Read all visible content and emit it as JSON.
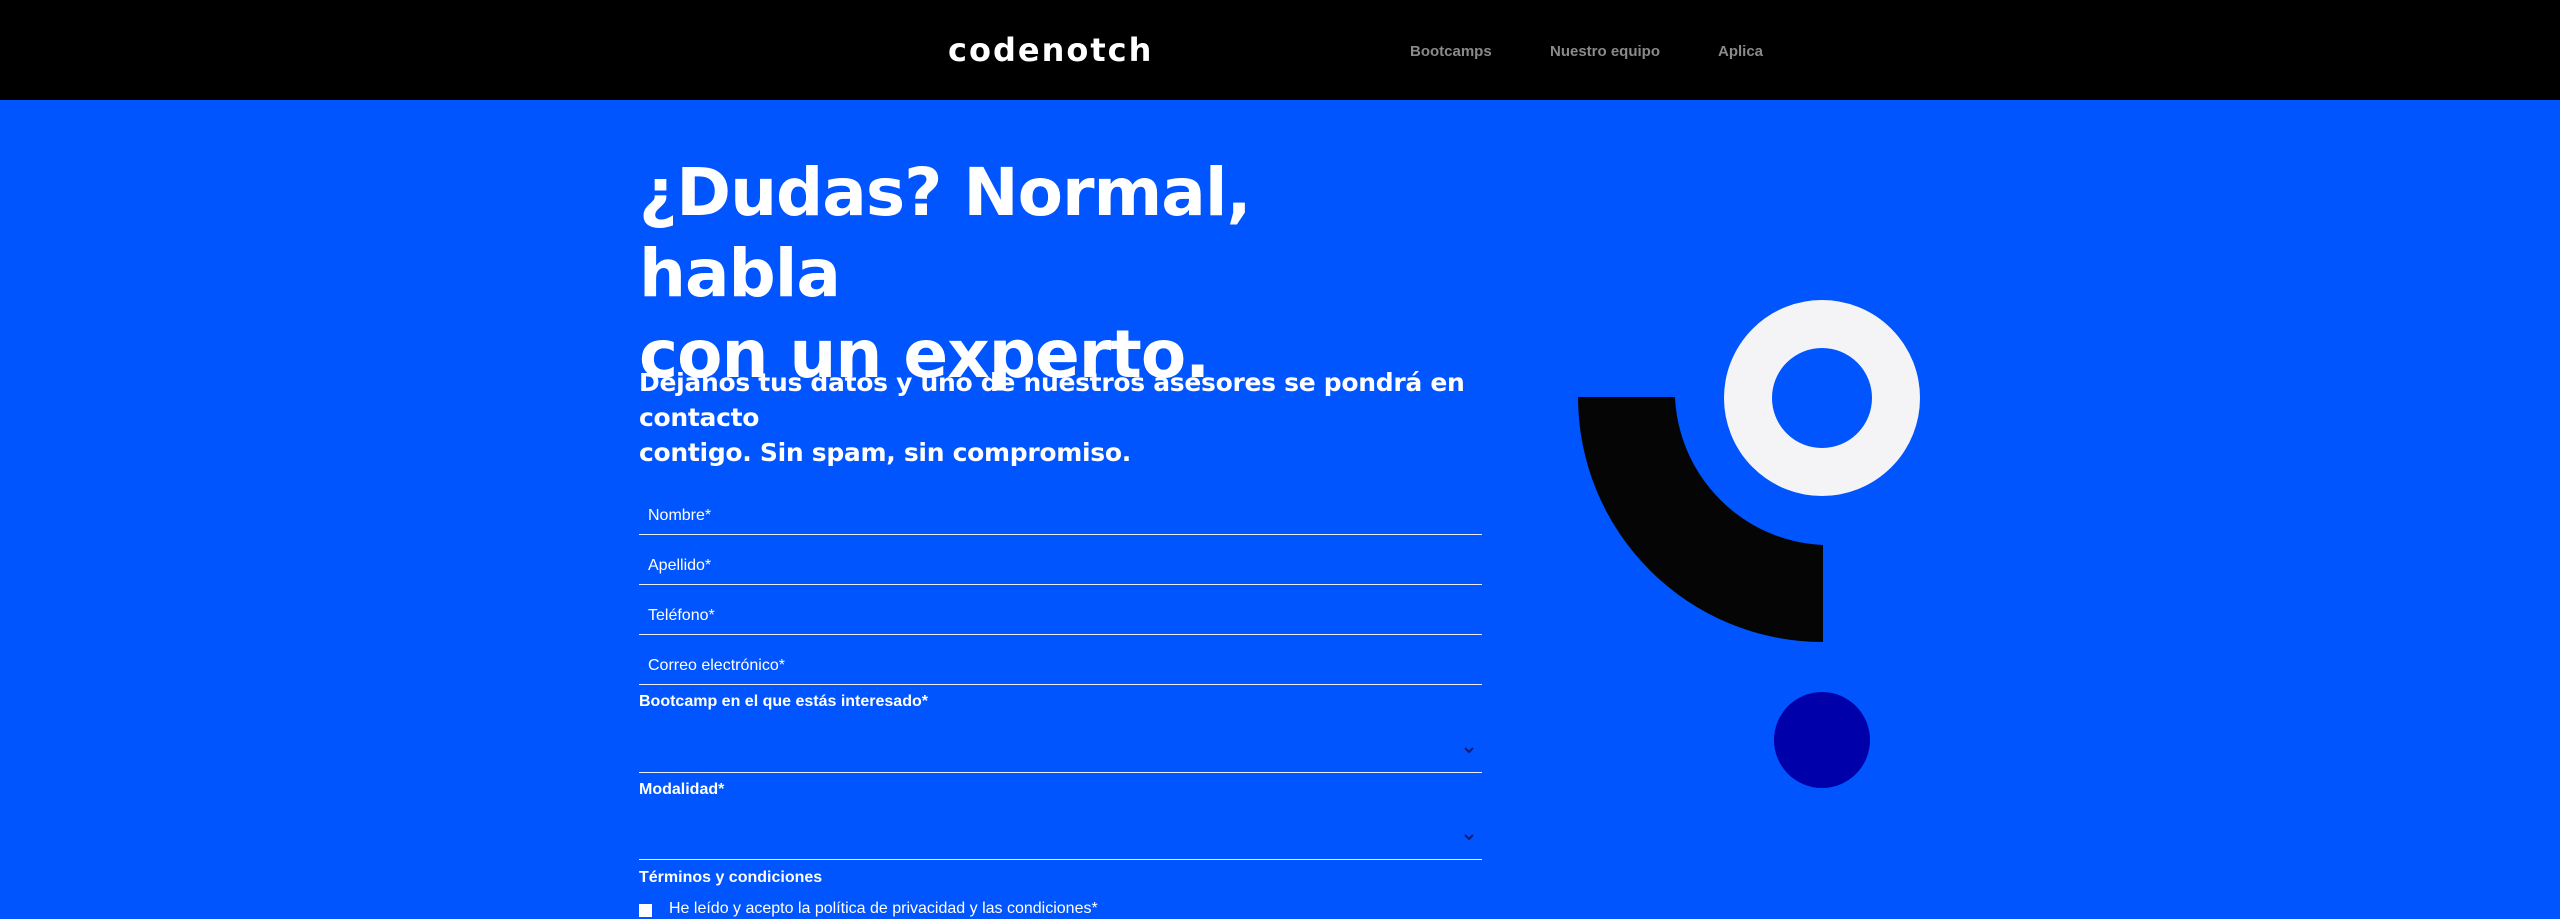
{
  "header": {
    "logo": "codenotch",
    "nav": [
      {
        "label": "Bootcamps"
      },
      {
        "label": "Nuestro equipo"
      },
      {
        "label": "Aplica"
      }
    ]
  },
  "hero": {
    "title_line1": "¿Dudas? Normal, habla",
    "title_line2": "con un experto.",
    "subtitle_line1": "Déjanos tus datos y uno de nuestros asesores se pondrá en contacto",
    "subtitle_line2": "contigo. Sin spam, sin compromiso."
  },
  "form": {
    "fields": [
      {
        "placeholder": "Nombre*",
        "value": ""
      },
      {
        "placeholder": "Apellido*",
        "value": ""
      },
      {
        "placeholder": "Teléfono*",
        "value": ""
      },
      {
        "placeholder": "Correo electrónico*",
        "value": ""
      }
    ],
    "bootcamp": {
      "label": "Bootcamp en el que estás interesado*",
      "selected": ""
    },
    "modalidad": {
      "label": "Modalidad*",
      "selected": ""
    },
    "terms": {
      "label": "Términos y condiciones",
      "checkbox_text": "He leído y acepto la política de privacidad y las condiciones*"
    }
  },
  "colors": {
    "background": "#0055ff",
    "header": "#000000",
    "shape_light": "#f4f4f6",
    "shape_dark": "#050505",
    "shape_navy": "#0000aa"
  },
  "icons": {
    "select_indicator": "chevron-down-icon"
  }
}
